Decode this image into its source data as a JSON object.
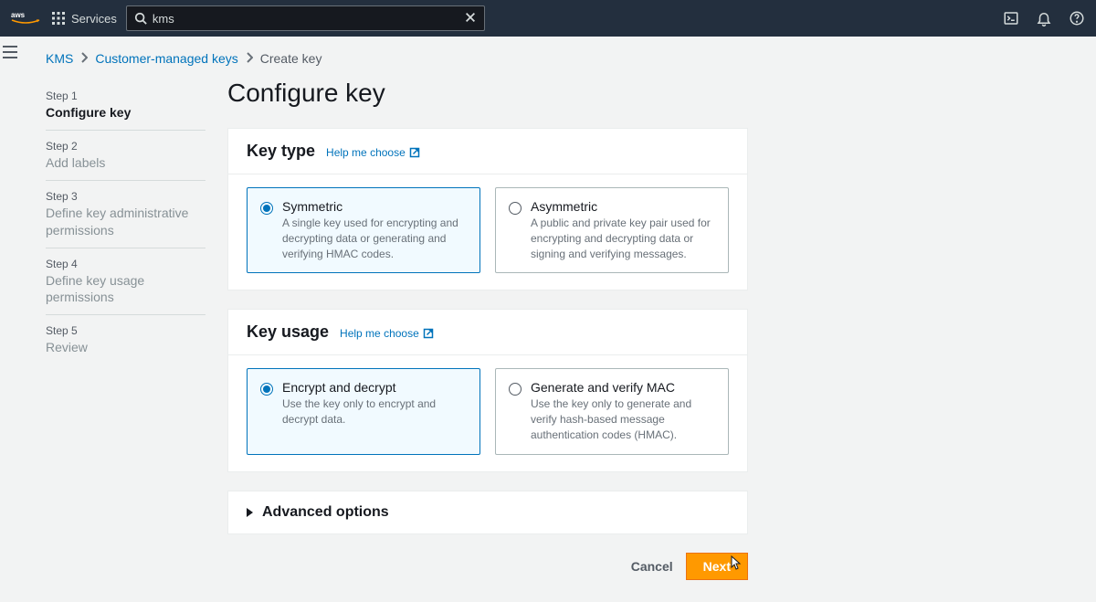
{
  "nav": {
    "services_label": "Services",
    "search_value": "kms"
  },
  "breadcrumb": {
    "root": "KMS",
    "mid": "Customer-managed keys",
    "current": "Create key"
  },
  "steps": [
    {
      "num": "Step 1",
      "label": "Configure key",
      "active": true
    },
    {
      "num": "Step 2",
      "label": "Add labels",
      "active": false
    },
    {
      "num": "Step 3",
      "label": "Define key administrative permissions",
      "active": false
    },
    {
      "num": "Step 4",
      "label": "Define key usage permissions",
      "active": false
    },
    {
      "num": "Step 5",
      "label": "Review",
      "active": false
    }
  ],
  "page_title": "Configure key",
  "key_type": {
    "title": "Key type",
    "help": "Help me choose",
    "options": [
      {
        "title": "Symmetric",
        "desc": "A single key used for encrypting and decrypting data or generating and verifying HMAC codes.",
        "selected": true
      },
      {
        "title": "Asymmetric",
        "desc": "A public and private key pair used for encrypting and decrypting data or signing and verifying messages.",
        "selected": false
      }
    ]
  },
  "key_usage": {
    "title": "Key usage",
    "help": "Help me choose",
    "options": [
      {
        "title": "Encrypt and decrypt",
        "desc": "Use the key only to encrypt and decrypt data.",
        "selected": true
      },
      {
        "title": "Generate and verify MAC",
        "desc": "Use the key only to generate and verify hash-based message authentication codes (HMAC).",
        "selected": false
      }
    ]
  },
  "advanced": {
    "title": "Advanced options"
  },
  "buttons": {
    "cancel": "Cancel",
    "next": "Next"
  }
}
